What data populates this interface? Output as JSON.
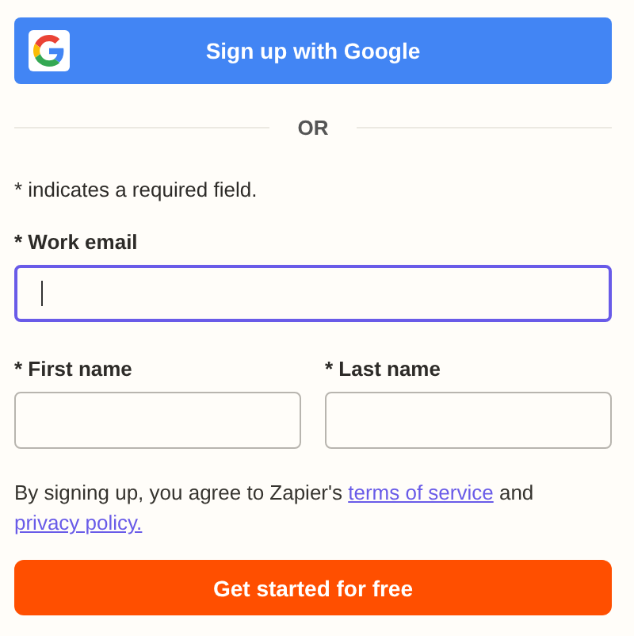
{
  "google_button": {
    "label": "Sign up with Google"
  },
  "divider": {
    "label": "OR"
  },
  "required_note": "* indicates a required field.",
  "email_field": {
    "label": "* Work email",
    "focused": true
  },
  "name_fields": [
    {
      "label": "* First name",
      "focused": false
    },
    {
      "label": "* Last name",
      "focused": false
    }
  ],
  "consent": {
    "before": "By signing up, you agree to Zapier's",
    "terms_link": "terms of service",
    "middle": "and",
    "privacy_link": "privacy policy."
  },
  "submit_button": {
    "label": "Get started for free"
  }
}
